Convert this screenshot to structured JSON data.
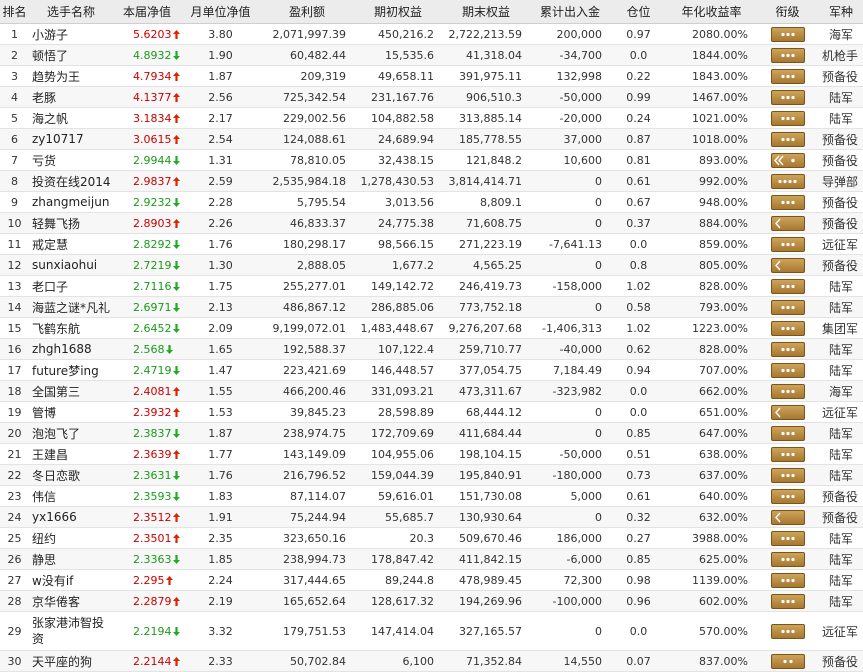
{
  "headers": [
    "排名",
    "选手名称",
    "本届净值",
    "月单位净值",
    "盈利额",
    "期初权益",
    "期末权益",
    "累计出入金",
    "仓位",
    "年化收益率",
    "衔级",
    "军种"
  ],
  "colors": {
    "up_value": "#cc0000",
    "down_value": "#1a9a1a",
    "badge": "#c19144"
  },
  "rows": [
    {
      "rank": "1",
      "name": "小游子",
      "nav": "5.6203",
      "dir": "up",
      "month": "3.80",
      "profit": "2,071,997.39",
      "start": "450,216.2",
      "end": "2,722,213.59",
      "flow": "200,000",
      "pos": "0.97",
      "annual": "2080.00%",
      "badge": "dots3",
      "branch": "海军"
    },
    {
      "rank": "2",
      "name": "顿悟了",
      "nav": "4.8932",
      "dir": "down",
      "month": "1.90",
      "profit": "60,482.44",
      "start": "15,535.6",
      "end": "41,318.04",
      "flow": "-34,700",
      "pos": "0.0",
      "annual": "1844.00%",
      "badge": "dots3",
      "branch": "机枪手"
    },
    {
      "rank": "3",
      "name": "趋势为王",
      "nav": "4.7934",
      "dir": "up",
      "month": "1.87",
      "profit": "209,319",
      "start": "49,658.11",
      "end": "391,975.11",
      "flow": "132,998",
      "pos": "0.22",
      "annual": "1843.00%",
      "badge": "dots3",
      "branch": "预备役"
    },
    {
      "rank": "4",
      "name": "老豚",
      "nav": "4.1377",
      "dir": "up",
      "month": "2.56",
      "profit": "725,342.54",
      "start": "231,167.76",
      "end": "906,510.3",
      "flow": "-50,000",
      "pos": "0.99",
      "annual": "1467.00%",
      "badge": "dots3",
      "branch": "陆军"
    },
    {
      "rank": "5",
      "name": "海之帆",
      "nav": "3.1834",
      "dir": "up",
      "month": "2.17",
      "profit": "229,002.56",
      "start": "104,882.58",
      "end": "313,885.14",
      "flow": "-20,000",
      "pos": "0.24",
      "annual": "1021.00%",
      "badge": "dots3",
      "branch": "陆军"
    },
    {
      "rank": "6",
      "name": "zy10717",
      "nav": "3.0615",
      "dir": "up",
      "month": "2.54",
      "profit": "124,088.61",
      "start": "24,689.94",
      "end": "185,778.55",
      "flow": "37,000",
      "pos": "0.87",
      "annual": "1018.00%",
      "badge": "dots3",
      "branch": "预备役"
    },
    {
      "rank": "7",
      "name": "亏货",
      "nav": "2.9944",
      "dir": "down",
      "month": "1.31",
      "profit": "78,810.05",
      "start": "32,438.15",
      "end": "121,848.2",
      "flow": "10,600",
      "pos": "0.81",
      "annual": "893.00%",
      "badge": "chevron-star",
      "branch": "预备役"
    },
    {
      "rank": "8",
      "name": "投资在线2014",
      "nav": "2.9837",
      "dir": "up",
      "month": "2.59",
      "profit": "2,535,984.18",
      "start": "1,278,430.53",
      "end": "3,814,414.71",
      "flow": "0",
      "pos": "0.61",
      "annual": "992.00%",
      "badge": "dots4",
      "branch": "导弹部"
    },
    {
      "rank": "9",
      "name": "zhangmeijun",
      "nav": "2.9232",
      "dir": "down",
      "month": "2.28",
      "profit": "5,795.54",
      "start": "3,013.56",
      "end": "8,809.1",
      "flow": "0",
      "pos": "0.67",
      "annual": "948.00%",
      "badge": "dots3",
      "branch": "预备役"
    },
    {
      "rank": "10",
      "name": "轻舞飞扬",
      "nav": "2.8903",
      "dir": "up",
      "month": "2.26",
      "profit": "46,833.37",
      "start": "24,775.38",
      "end": "71,608.75",
      "flow": "0",
      "pos": "0.37",
      "annual": "884.00%",
      "badge": "chevron",
      "branch": "预备役"
    },
    {
      "rank": "11",
      "name": "戒定慧",
      "nav": "2.8292",
      "dir": "down",
      "month": "1.76",
      "profit": "180,298.17",
      "start": "98,566.15",
      "end": "271,223.19",
      "flow": "-7,641.13",
      "pos": "0.0",
      "annual": "859.00%",
      "badge": "dots3",
      "branch": "远征军"
    },
    {
      "rank": "12",
      "name": "sunxiaohui",
      "nav": "2.7219",
      "dir": "down",
      "month": "1.30",
      "profit": "2,888.05",
      "start": "1,677.2",
      "end": "4,565.25",
      "flow": "0",
      "pos": "0.8",
      "annual": "805.00%",
      "badge": "chevron",
      "branch": "预备役"
    },
    {
      "rank": "13",
      "name": "老口子",
      "nav": "2.7116",
      "dir": "down",
      "month": "1.75",
      "profit": "255,277.01",
      "start": "149,142.72",
      "end": "246,419.73",
      "flow": "-158,000",
      "pos": "1.02",
      "annual": "828.00%",
      "badge": "dots3",
      "branch": "陆军"
    },
    {
      "rank": "14",
      "name": "海蓝之谜*凡礼",
      "nav": "2.6971",
      "dir": "down",
      "month": "2.13",
      "profit": "486,867.12",
      "start": "286,885.06",
      "end": "773,752.18",
      "flow": "0",
      "pos": "0.58",
      "annual": "793.00%",
      "badge": "dots3",
      "branch": "陆军"
    },
    {
      "rank": "15",
      "name": "飞鹤东航",
      "nav": "2.6452",
      "dir": "down",
      "month": "2.09",
      "profit": "9,199,072.01",
      "start": "1,483,448.67",
      "end": "9,276,207.68",
      "flow": "-1,406,313",
      "pos": "1.02",
      "annual": "1223.00%",
      "badge": "dots3",
      "branch": "集团军"
    },
    {
      "rank": "16",
      "name": "zhgh1688",
      "nav": "2.568",
      "dir": "down",
      "month": "1.65",
      "profit": "192,588.37",
      "start": "107,122.4",
      "end": "259,710.77",
      "flow": "-40,000",
      "pos": "0.62",
      "annual": "828.00%",
      "badge": "dots3",
      "branch": "陆军"
    },
    {
      "rank": "17",
      "name": "future梦ing",
      "nav": "2.4719",
      "dir": "down",
      "month": "1.47",
      "profit": "223,421.69",
      "start": "146,448.57",
      "end": "377,054.75",
      "flow": "7,184.49",
      "pos": "0.94",
      "annual": "707.00%",
      "badge": "dots3",
      "branch": "陆军"
    },
    {
      "rank": "18",
      "name": "全国第三",
      "nav": "2.4081",
      "dir": "up",
      "month": "1.55",
      "profit": "466,200.46",
      "start": "331,093.21",
      "end": "473,311.67",
      "flow": "-323,982",
      "pos": "0.0",
      "annual": "662.00%",
      "badge": "dots3",
      "branch": "海军"
    },
    {
      "rank": "19",
      "name": "管博",
      "nav": "2.3932",
      "dir": "up",
      "month": "1.53",
      "profit": "39,845.23",
      "start": "28,598.89",
      "end": "68,444.12",
      "flow": "0",
      "pos": "0.0",
      "annual": "651.00%",
      "badge": "chevron",
      "branch": "远征军"
    },
    {
      "rank": "20",
      "name": "泡泡飞了",
      "nav": "2.3837",
      "dir": "down",
      "month": "1.87",
      "profit": "238,974.75",
      "start": "172,709.69",
      "end": "411,684.44",
      "flow": "0",
      "pos": "0.85",
      "annual": "647.00%",
      "badge": "dots3",
      "branch": "陆军"
    },
    {
      "rank": "21",
      "name": "王建昌",
      "nav": "2.3639",
      "dir": "up",
      "month": "1.77",
      "profit": "143,149.09",
      "start": "104,955.06",
      "end": "198,104.15",
      "flow": "-50,000",
      "pos": "0.51",
      "annual": "638.00%",
      "badge": "dots3",
      "branch": "陆军"
    },
    {
      "rank": "22",
      "name": "冬日恋歌",
      "nav": "2.3631",
      "dir": "down",
      "month": "1.76",
      "profit": "216,796.52",
      "start": "159,044.39",
      "end": "195,840.91",
      "flow": "-180,000",
      "pos": "0.73",
      "annual": "637.00%",
      "badge": "dots3",
      "branch": "陆军"
    },
    {
      "rank": "23",
      "name": "伟信",
      "nav": "2.3593",
      "dir": "down",
      "month": "1.83",
      "profit": "87,114.07",
      "start": "59,616.01",
      "end": "151,730.08",
      "flow": "5,000",
      "pos": "0.61",
      "annual": "640.00%",
      "badge": "dots3",
      "branch": "预备役"
    },
    {
      "rank": "24",
      "name": "yx1666",
      "nav": "2.3512",
      "dir": "up",
      "month": "1.91",
      "profit": "75,244.94",
      "start": "55,685.7",
      "end": "130,930.64",
      "flow": "0",
      "pos": "0.32",
      "annual": "632.00%",
      "badge": "chevron",
      "branch": "预备役"
    },
    {
      "rank": "25",
      "name": "纽约",
      "nav": "2.3501",
      "dir": "up",
      "month": "2.35",
      "profit": "323,650.16",
      "start": "20.3",
      "end": "509,670.46",
      "flow": "186,000",
      "pos": "0.27",
      "annual": "3988.00%",
      "badge": "dots3",
      "branch": "陆军"
    },
    {
      "rank": "26",
      "name": "静思",
      "nav": "2.3363",
      "dir": "down",
      "month": "1.85",
      "profit": "238,994.73",
      "start": "178,847.42",
      "end": "411,842.15",
      "flow": "-6,000",
      "pos": "0.85",
      "annual": "625.00%",
      "badge": "dots3",
      "branch": "陆军"
    },
    {
      "rank": "27",
      "name": "w没有if",
      "nav": "2.295",
      "dir": "up",
      "month": "2.24",
      "profit": "317,444.65",
      "start": "89,244.8",
      "end": "478,989.45",
      "flow": "72,300",
      "pos": "0.98",
      "annual": "1139.00%",
      "badge": "dots3",
      "branch": "陆军"
    },
    {
      "rank": "28",
      "name": "京华倦客",
      "nav": "2.2879",
      "dir": "up",
      "month": "2.19",
      "profit": "165,652.64",
      "start": "128,617.32",
      "end": "194,269.96",
      "flow": "-100,000",
      "pos": "0.96",
      "annual": "602.00%",
      "badge": "dots3",
      "branch": "陆军"
    },
    {
      "rank": "29",
      "name": "张家港沛智投资",
      "nav": "2.2194",
      "dir": "down",
      "month": "3.32",
      "profit": "179,751.53",
      "start": "147,414.04",
      "end": "327,165.57",
      "flow": "0",
      "pos": "0.0",
      "annual": "570.00%",
      "badge": "dots3",
      "branch": "远征军"
    },
    {
      "rank": "30",
      "name": "天平座的狗",
      "nav": "2.2144",
      "dir": "up",
      "month": "2.33",
      "profit": "50,702.84",
      "start": "6,100",
      "end": "71,352.84",
      "flow": "14,550",
      "pos": "0.07",
      "annual": "837.00%",
      "badge": "dots2",
      "branch": "预备役"
    }
  ]
}
